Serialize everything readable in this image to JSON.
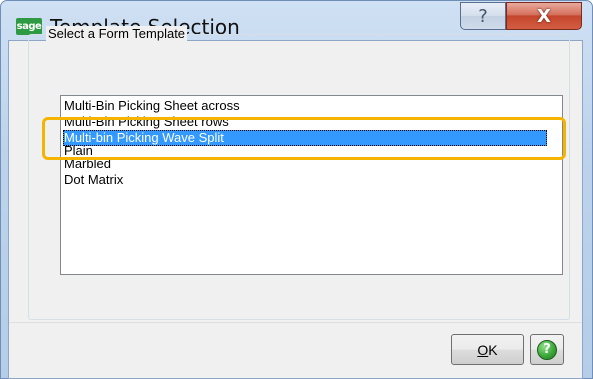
{
  "window": {
    "title": "Template Selection",
    "app_logo_text": "sage",
    "help_button_glyph": "?",
    "close_button_glyph": "X"
  },
  "group": {
    "label": "Select a Form Template"
  },
  "templates": {
    "items": [
      "Multi-Bin Picking Sheet across",
      "Multi-Bin Picking Sheet rows",
      "Multi-bin Picking Wave Split",
      "Plain",
      "Marbled",
      "Dot Matrix"
    ],
    "selected": "Multi-bin Picking Wave Split"
  },
  "buttons": {
    "ok_mnemonic": "O",
    "ok_rest": "K",
    "help_glyph": "?"
  },
  "colors": {
    "selection": "#3399ff",
    "annotation": "#f5b400",
    "close": "#c5452c"
  },
  "icons": {
    "app": "sage-logo-icon",
    "help": "question-mark-icon",
    "close": "close-x-icon",
    "help_button": "green-help-icon"
  }
}
